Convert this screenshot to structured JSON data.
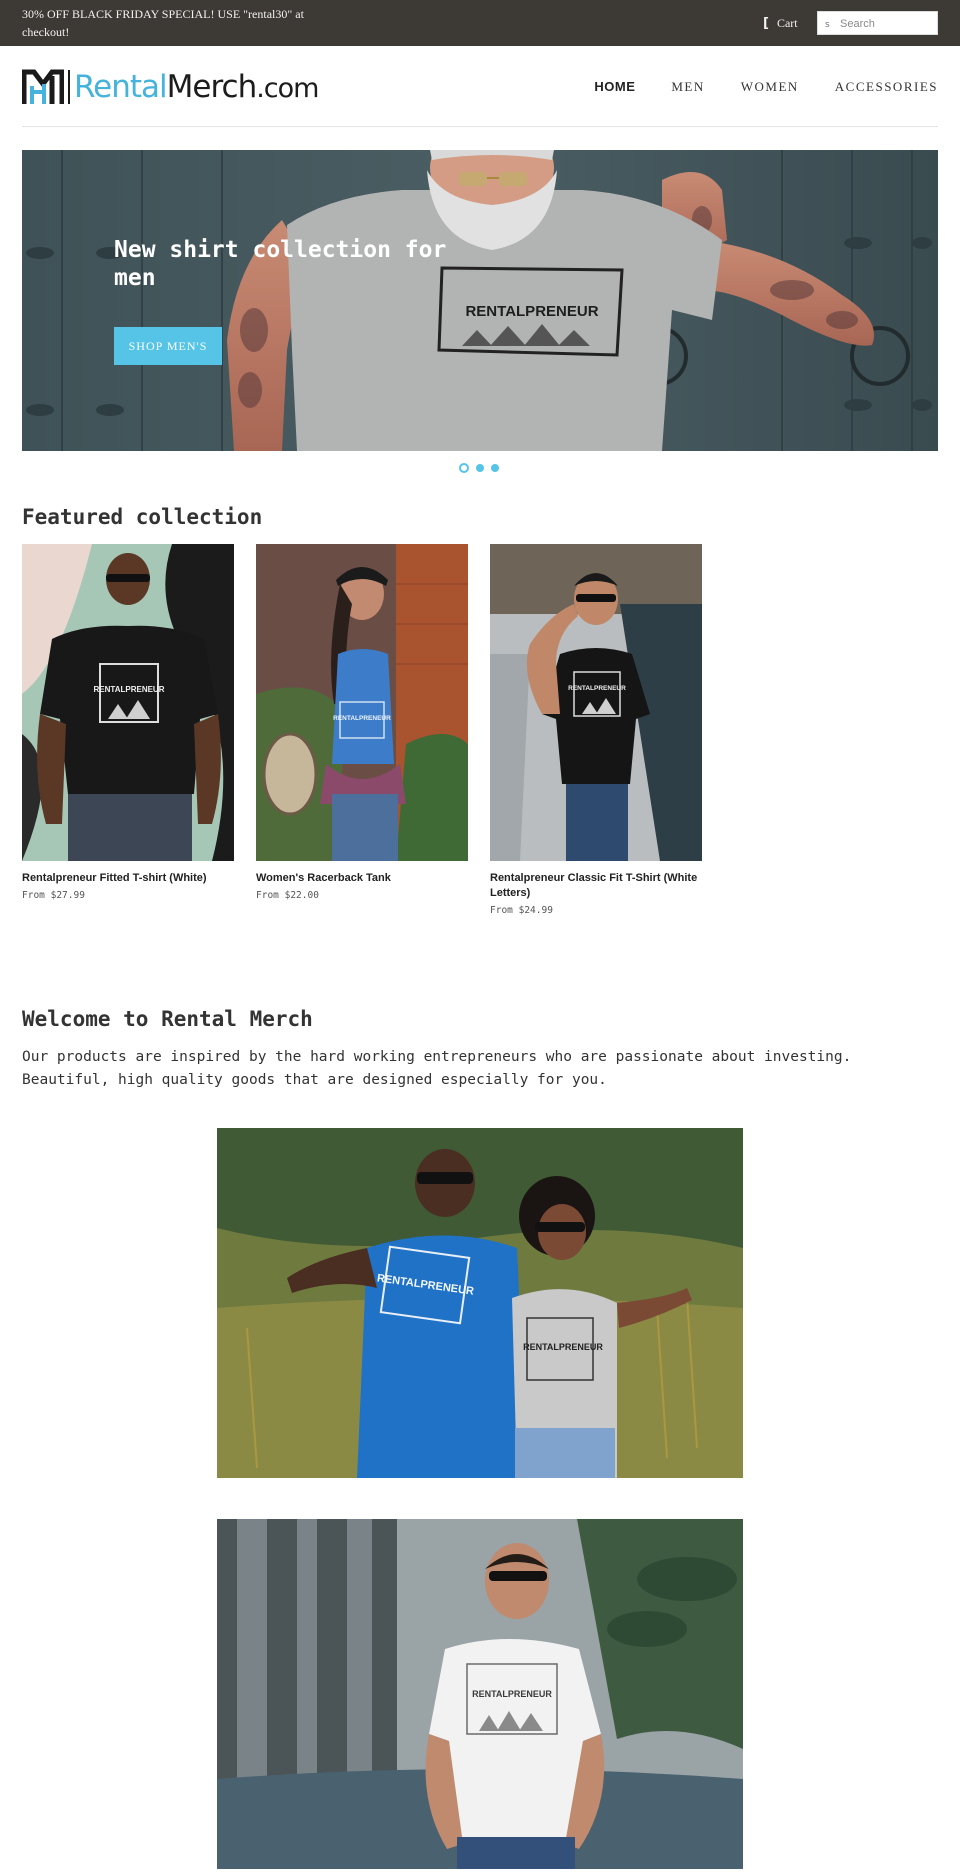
{
  "announcement": {
    "text": "30% OFF BLACK FRIDAY SPECIAL! USE \"rental30\" at checkout!"
  },
  "topbar": {
    "cart_label": "Cart",
    "search_placeholder": "Search"
  },
  "header": {
    "logo_text_rental": "Rental",
    "logo_text_merch": "Merch",
    "logo_text_com": ".com",
    "nav": [
      {
        "label": "HOME",
        "active": true
      },
      {
        "label": "MEN",
        "active": false
      },
      {
        "label": "WOMEN",
        "active": false
      },
      {
        "label": "ACCESSORIES",
        "active": false
      }
    ]
  },
  "hero": {
    "title": "New shirt collection for men",
    "button_label": "SHOP MEN'S",
    "shirt_print": "RENTALPRENEUR",
    "slide_count": 3,
    "active_slide": 1
  },
  "featured": {
    "title": "Featured collection",
    "products": [
      {
        "name": "Rentalpreneur Fitted T-shirt (White)",
        "price": "From $27.99",
        "print": "RENTALPRENEUR"
      },
      {
        "name": "Women's Racerback Tank",
        "price": "From $22.00",
        "print": "RENTALPRENEUR"
      },
      {
        "name": "Rentalpreneur Classic Fit T-Shirt (White Letters)",
        "price": "From $24.99",
        "print": "RENTALPRENEUR"
      }
    ]
  },
  "welcome": {
    "title": "Welcome to Rental Merch",
    "text": "Our products are inspired by the hard working entrepreneurs who are passionate about investing. Beautiful, high quality goods that are designed especially for you.",
    "photo_prints": [
      "RENTALPRENEUR",
      "RENTALPRENEUR",
      "RENTALPRENEUR"
    ]
  },
  "colors": {
    "topbar": "#3d3935",
    "accent": "#55c4e6",
    "logo_blue": "#45b3dc",
    "text": "#333333"
  },
  "icons": {
    "cart": "cart-icon",
    "search": "search-icon"
  }
}
